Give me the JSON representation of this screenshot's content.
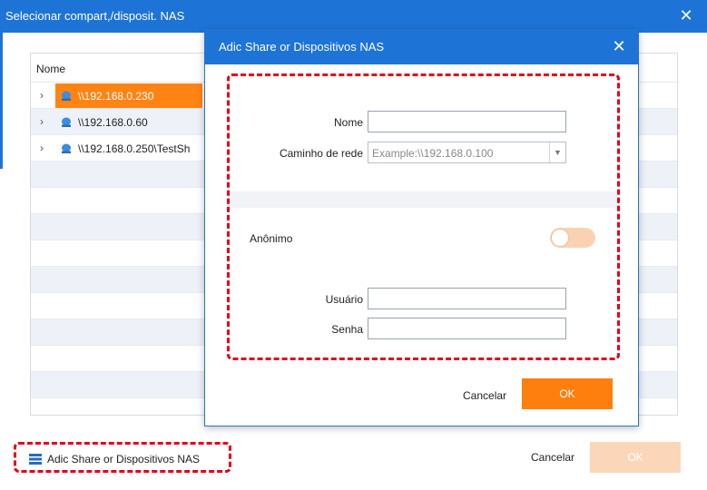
{
  "outer": {
    "title": "Selecionar compart,/disposit. NAS",
    "column_header": "Nome",
    "rows": [
      {
        "label": "\\\\192.168.0.230",
        "selected": true
      },
      {
        "label": "\\\\192.168.0.60",
        "selected": false
      },
      {
        "label": "\\\\192.168.0.250\\TestSh",
        "selected": false
      }
    ],
    "add_share_label": "Adic Share or Dispositivos NAS",
    "cancel_label": "Cancelar",
    "ok_label": "OK"
  },
  "modal": {
    "title": "Adic Share or Dispositivos NAS",
    "name_label": "Nome",
    "name_value": "",
    "path_label": "Caminho de rede",
    "path_placeholder": "Example:\\\\192.168.0.100",
    "anon_label": "Anônimo",
    "anon_on": false,
    "user_label": "Usuário",
    "user_value": "",
    "pass_label": "Senha",
    "pass_value": "",
    "cancel_label": "Cancelar",
    "ok_label": "OK"
  },
  "colors": {
    "title_blue": "#1e74d6",
    "accent_orange": "#ff7f0e",
    "highlight_red": "#e4001b",
    "disabled_ok": "#fcd6b8"
  },
  "icons": {
    "close": "close-icon",
    "chevron": "chevron-right-icon",
    "network_drive": "network-drive-icon",
    "server": "server-icon",
    "dropdown": "chevron-down-icon"
  }
}
